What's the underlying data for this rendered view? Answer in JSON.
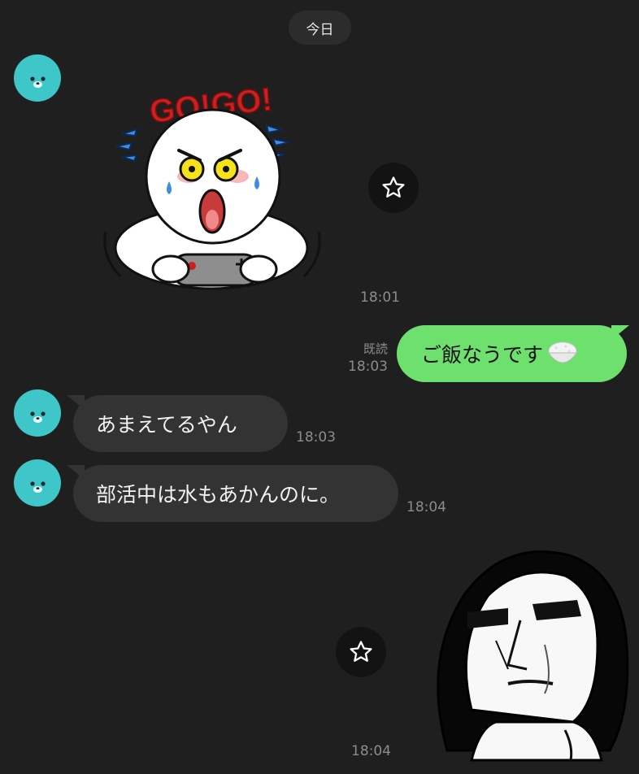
{
  "date_separator": "今日",
  "messages": [
    {
      "type": "sticker",
      "direction": "incoming",
      "sticker_text": "GO!GO!",
      "time": "18:01"
    },
    {
      "type": "text",
      "direction": "outgoing",
      "text": "ご飯なうです",
      "emoji": "rice-bowl",
      "read_label": "既読",
      "time": "18:03"
    },
    {
      "type": "text",
      "direction": "incoming",
      "text": "あまえてるやん",
      "time": "18:03"
    },
    {
      "type": "text",
      "direction": "incoming",
      "text": "部活中は水もあかんのに。",
      "time": "18:04"
    },
    {
      "type": "sticker",
      "direction": "incoming",
      "time": "18:04"
    }
  ],
  "colors": {
    "background": "#1f1f1f",
    "incoming_bubble": "#333333",
    "outgoing_bubble": "#6de06e",
    "avatar": "#3fc6c9",
    "timestamp": "#8c8c8c"
  },
  "icons": [
    "seal-avatar-icon",
    "star-icon"
  ]
}
